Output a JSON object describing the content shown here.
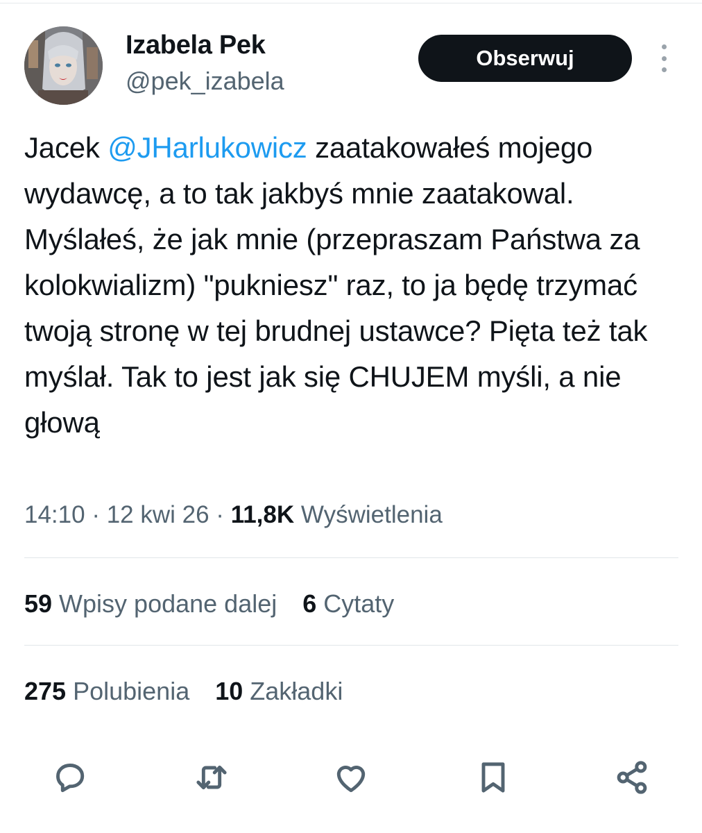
{
  "author": {
    "display_name": "Izabela Pek",
    "handle": "@pek_izabela"
  },
  "follow_button": {
    "label": "Obserwuj"
  },
  "more_menu": {
    "icon": "more-vertical-icon"
  },
  "tweet": {
    "text_before": "Jacek ",
    "mention": "@JHarlukowicz",
    "text_after": " zaatakowałeś mojego wydawcę, a to tak jakbyś mnie zaatakowal. Myślałeś, że jak mnie (przepraszam Państwa za kolokwializm) \"pukniesz\" raz, to ja będę trzymać twoją stronę w tej brudnej ustawce? Pięta też tak myślał. Tak to jest jak się CHUJEM myśli, a nie głową"
  },
  "meta": {
    "time": "14:10",
    "separator": " · ",
    "date": "12 kwi 26",
    "views_count": "11,8K",
    "views_label": " Wyświetlenia"
  },
  "stats": {
    "reposts": {
      "count": "59",
      "label": " Wpisy podane dalej"
    },
    "quotes": {
      "count": "6",
      "label": " Cytaty"
    },
    "likes": {
      "count": "275",
      "label": " Polubienia"
    },
    "bookmarks": {
      "count": "10",
      "label": " Zakładki"
    }
  },
  "actions": [
    {
      "icon": "reply-icon"
    },
    {
      "icon": "repost-icon"
    },
    {
      "icon": "like-icon"
    },
    {
      "icon": "bookmark-icon"
    },
    {
      "icon": "share-icon"
    }
  ],
  "colors": {
    "text": "#0f1419",
    "secondary": "#536471",
    "link": "#1d9bf0",
    "button_bg": "#0f1419",
    "divider": "#e1e6e9"
  }
}
